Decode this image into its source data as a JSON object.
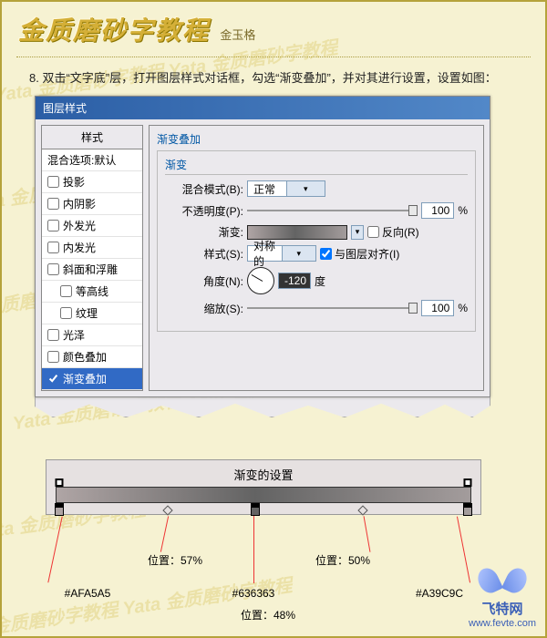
{
  "header": {
    "title": "金质磨砂字教程",
    "subtitle": "金玉格"
  },
  "step": {
    "number": "8.",
    "text": "双击“文字底”层，打开图层样式对话框，勾选“渐变叠加”，并对其进行设置，设置如图："
  },
  "dialog": {
    "title": "图层样式",
    "styles_header": "样式",
    "blend_default": "混合选项:默认",
    "items": [
      {
        "label": "投影",
        "checked": false
      },
      {
        "label": "内阴影",
        "checked": false
      },
      {
        "label": "外发光",
        "checked": false
      },
      {
        "label": "内发光",
        "checked": false
      },
      {
        "label": "斜面和浮雕",
        "checked": false
      },
      {
        "label": "等高线",
        "checked": false,
        "indent": true
      },
      {
        "label": "纹理",
        "checked": false,
        "indent": true
      },
      {
        "label": "光泽",
        "checked": false
      },
      {
        "label": "颜色叠加",
        "checked": false
      },
      {
        "label": "渐变叠加",
        "checked": true,
        "selected": true
      }
    ],
    "panel": {
      "group_title": "渐变叠加",
      "group_sub": "渐变",
      "blend_mode": {
        "label": "混合模式(B):",
        "value": "正常"
      },
      "opacity": {
        "label": "不透明度(P):",
        "value": "100",
        "unit": "%"
      },
      "gradient": {
        "label": "渐变:",
        "reverse_label": "反向(R)",
        "reverse_checked": false
      },
      "style": {
        "label": "样式(S):",
        "value": "对称的",
        "align_label": "与图层对齐(I)",
        "align_checked": true
      },
      "angle": {
        "label": "角度(N):",
        "value": "-120",
        "unit": "度"
      },
      "scale": {
        "label": "缩放(S):",
        "value": "100",
        "unit": "%"
      }
    }
  },
  "gradient_editor": {
    "title": "渐变的设置",
    "stops": [
      {
        "pos": 0,
        "color": "#AFA5A5"
      },
      {
        "pos": 48,
        "color": "#636363"
      },
      {
        "pos": 100,
        "color": "#A39C9C"
      }
    ],
    "midpoints": [
      {
        "pos": 57,
        "rel_between": "0-48"
      },
      {
        "pos": 50,
        "rel_between": "48-100"
      }
    ],
    "labels": {
      "pos_prefix": "位置：",
      "mid1": "57%",
      "mid2": "50%",
      "bottom_pos": "48%",
      "c1": "#AFA5A5",
      "c2": "#636363",
      "c3": "#A39C9C"
    }
  },
  "footer": {
    "site_name": "飞特网",
    "url": "www.fevte.com"
  },
  "watermark": "Yata 金质磨砂字教程"
}
